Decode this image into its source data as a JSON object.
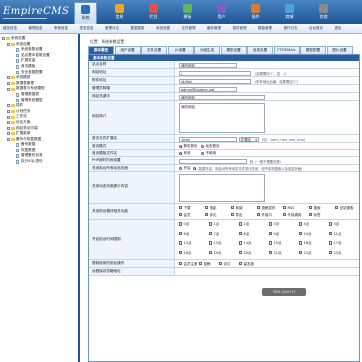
{
  "header": {
    "logo": "EmpireCMS",
    "tabs": [
      {
        "label": "系统",
        "color": "#2a6fb8",
        "active": true
      },
      {
        "label": "信息",
        "color": "#e9a82b"
      },
      {
        "label": "栏目",
        "color": "#d9534f"
      },
      {
        "label": "模板",
        "color": "#5cb85c"
      },
      {
        "label": "用户",
        "color": "#7b61c9"
      },
      {
        "label": "插件",
        "color": "#e07a2d"
      },
      {
        "label": "商城",
        "color": "#4aa3df"
      },
      {
        "label": "其他",
        "color": "#8a8a8a"
      }
    ]
  },
  "submenu": [
    "增加信息",
    "管理信息",
    "审核信息",
    "签发信息",
    "管理评论",
    "数据更新",
    "系统设置",
    "文件管理",
    "缓存管理",
    "插件管理",
    "模板管理",
    "操作日志",
    "后台首页",
    "退出"
  ],
  "sidebar": {
    "items": [
      {
        "label": "系统设置",
        "depth": 0,
        "type": "folder"
      },
      {
        "label": "系统设置",
        "depth": 1,
        "type": "folder"
      },
      {
        "label": "系统参数设置",
        "depth": 2,
        "type": "page"
      },
      {
        "label": "站点基本参数设置",
        "depth": 2,
        "type": "page"
      },
      {
        "label": "扩展变量",
        "depth": 2,
        "type": "page"
      },
      {
        "label": "首页模板",
        "depth": 2,
        "type": "page"
      },
      {
        "label": "安全参数配置",
        "depth": 2,
        "type": "page"
      },
      {
        "label": "系统模型",
        "depth": 1,
        "type": "folder"
      },
      {
        "label": "数据表管理",
        "depth": 1,
        "type": "folder"
      },
      {
        "label": "数据表与系统模型",
        "depth": 1,
        "type": "folder"
      },
      {
        "label": "管理数据表",
        "depth": 2,
        "type": "page"
      },
      {
        "label": "管理系统模型",
        "depth": 2,
        "type": "page"
      },
      {
        "label": "插件",
        "depth": 1,
        "type": "folder"
      },
      {
        "label": "计划任务",
        "depth": 1,
        "type": "folder"
      },
      {
        "label": "工作流",
        "depth": 1,
        "type": "folder"
      },
      {
        "label": "优化方案",
        "depth": 1,
        "type": "folder"
      },
      {
        "label": "网站多访问端",
        "depth": 1,
        "type": "folder"
      },
      {
        "label": "扩展菜单",
        "depth": 1,
        "type": "folder"
      },
      {
        "label": "备份与恢复数据",
        "depth": 1,
        "type": "folder"
      },
      {
        "label": "备份数据",
        "depth": 2,
        "type": "page"
      },
      {
        "label": "恢复数据",
        "depth": 2,
        "type": "page"
      },
      {
        "label": "管理备份目录",
        "depth": 2,
        "type": "page"
      },
      {
        "label": "执行SQL语句",
        "depth": 2,
        "type": "page"
      }
    ]
  },
  "location": "位置：系统参数设置",
  "tabs": [
    {
      "label": "基本属性",
      "active": true
    },
    {
      "label": "用户设置"
    },
    {
      "label": "文件设置"
    },
    {
      "label": "JS设置"
    },
    {
      "label": "分组生成"
    },
    {
      "label": "模型设置"
    },
    {
      "label": "信息设置"
    },
    {
      "label": "FTP/EMAIL"
    },
    {
      "label": "模型配置"
    },
    {
      "label": "图片设置"
    }
  ],
  "form": {
    "title": "基本参数设置",
    "site_name": {
      "label": "站点名称",
      "value": "我的网站"
    },
    "site_url": {
      "label": "网站地址",
      "value": "/",
      "hint": "(结尾需加\"/\"，如：/)"
    },
    "attach_url": {
      "label": "附件地址",
      "value": "/d/file/",
      "hint": "(附件地址后缀，结尾需加\"/\")"
    },
    "admin_email": {
      "label": "管理员邮箱",
      "value": "admin@phome.net"
    },
    "keywords": {
      "label": "网站关键字",
      "value": "我的网站"
    },
    "description": {
      "label": "网站简介",
      "value": "我的网站"
    },
    "index_ext": {
      "label": "首页文件扩展名",
      "value": ".html",
      "select": "扩展名",
      "hint": "(如：.html,.htm,.xml,.php)"
    },
    "index_mode": {
      "label": "首页模式",
      "options": [
        "静态首页",
        "动态首页"
      ],
      "selected": 0
    },
    "index_tpl": {
      "label": "首页模板文件名",
      "options": [
        "有效",
        "不使用"
      ],
      "selected": 0
    },
    "php_time": {
      "label": "PHP超时时间设置",
      "value": "",
      "hint": "秒（一般不需要设置）"
    },
    "close_site": {
      "label": "关闭前台所有动态页面",
      "options": [
        "开启",
        "关闭"
      ],
      "hint": "(如果开启，则会对所有动态文件进行关闭，但不影响搜索以及信息页面)"
    },
    "close_tip": {
      "label": "关闭动态页面提示内容",
      "value": ""
    },
    "close_modules": {
      "label": "关闭前台模块相关功能",
      "items": [
        "下载",
        "电影",
        "商城",
        "投稿发布",
        "RSS",
        "搜索",
        "全站搜索",
        "会员",
        "评论",
        "导出",
        "外接口",
        "外接调用",
        "标签"
      ]
    },
    "time_limits": {
      "label": "开启前台时间限制",
      "cells": [
        [
          "0点",
          "1点",
          "2点",
          "3点",
          "4点",
          "5点"
        ],
        [
          "6点",
          "7点",
          "8点",
          "9点",
          "10点",
          "11点"
        ],
        [
          "12点",
          "13点",
          "14点",
          "15点",
          "16点",
          "17点"
        ],
        [
          "18点",
          "19点",
          "20点",
          "21点",
          "22点",
          "23点"
        ]
      ]
    },
    "limit_ops": {
      "label": "限制使用的前台操作",
      "items": [
        "会员注册",
        "投稿",
        "评论",
        "留言板"
      ]
    },
    "remote_save": {
      "label": "远程保存忽略地址"
    }
  },
  "toast": "50% (Ctrl+?)"
}
